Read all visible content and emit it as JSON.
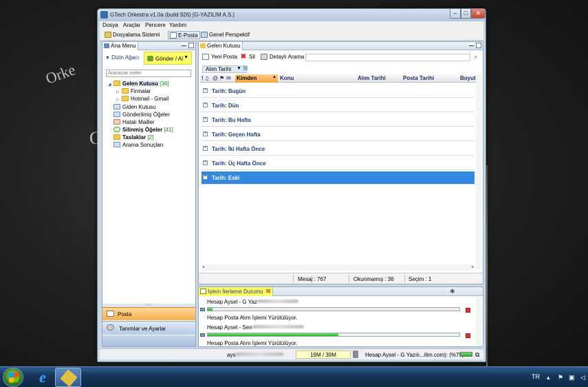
{
  "window": {
    "title": "GTech Orkestra v1.0a (build 926) [G-YAZILIM A.S.]",
    "min": "–",
    "max": "□",
    "close": "✕"
  },
  "menu": [
    "Dosya",
    "Araçlar",
    "Pencere",
    "Yardım"
  ],
  "perspectives": [
    {
      "label": "Dosyalama Sistemi",
      "icon": "folder-icon"
    },
    {
      "label": "E-Posta",
      "icon": "mail-icon",
      "active": true
    },
    {
      "label": "Genel Perspektif",
      "icon": "table-icon"
    }
  ],
  "left_panel": {
    "tab": "Ana Menu",
    "dizin_label": "Dizin Ağacı",
    "send_button": "Gönder / Al",
    "search_placeholder": "Aranacak metin",
    "tree": [
      {
        "label": "Gelen Kutusu",
        "count": "[36]",
        "bold": true,
        "twisty": "◢"
      },
      {
        "label": "Firmalar",
        "twisty": "▷"
      },
      {
        "label": "Hotmail - Gmail",
        "twisty": "▷"
      },
      {
        "label": "Giden Kutusu"
      },
      {
        "label": "Gönderilmiş Öğeler"
      },
      {
        "label": "Hatalı Mailler"
      },
      {
        "label": "Silinmiş Öğeler",
        "count": "[41]",
        "bold": true
      },
      {
        "label": "Taslaklar",
        "count": "[2]",
        "bold": true
      },
      {
        "label": "Arama Sonuçları"
      }
    ],
    "nav": [
      {
        "label": "Posta",
        "active": true
      },
      {
        "label": "Tanımlar ve Ayarlar"
      }
    ]
  },
  "inbox": {
    "tab": "Gelen Kutusu",
    "toolbar": {
      "new": "Yeni Posta",
      "delete": "Sil",
      "detail_search": "Detaylı Arama"
    },
    "sort_label": "Alım Tarihi",
    "columns": [
      "Kimden",
      "Konu",
      "Alım Tarihi",
      "Posta Tarihi",
      "Boyut"
    ],
    "groups": [
      "Tarih: Bugün",
      "Tarih: Dün",
      "Tarih: Bu Hafta",
      "Tarih: Geçen Hafta",
      "Tarih: İki Hafta Önce",
      "Tarih: Üç Hafta Önce",
      "Tarih: Eski"
    ],
    "selected_group": 6,
    "status": {
      "mesaj": "Mesaj : 767",
      "okunmamis": "Okunmamış : 36",
      "secim": "Seçim : 1"
    }
  },
  "progress_panel": {
    "tab": "İşlem İlerleme Durumu",
    "items": [
      {
        "title": "Hesap Aysel - G Yaz",
        "detail": "Hesap Posta Alım İşlemi Yürütülüyor.",
        "progress": 0.02
      },
      {
        "title": "Hesap Aysel - Sen",
        "detail": "Hesap Posta Alım İşlemi Yürütülüyor.",
        "progress": 0.52
      }
    ],
    "third_title": "Hesap Posta Alım İşlemi Yürütülüyor."
  },
  "statusbar": {
    "user": "ays",
    "memory": "19M / 39M",
    "task": "Hesap Aysel - G Yazılı...ilim.com): (%79)"
  },
  "taskbar": {
    "lang": "TR"
  },
  "colors": {
    "accent_orange": "#f6a23c",
    "selection_blue": "#3388e0",
    "highlight_yellow": "#ffff66"
  }
}
